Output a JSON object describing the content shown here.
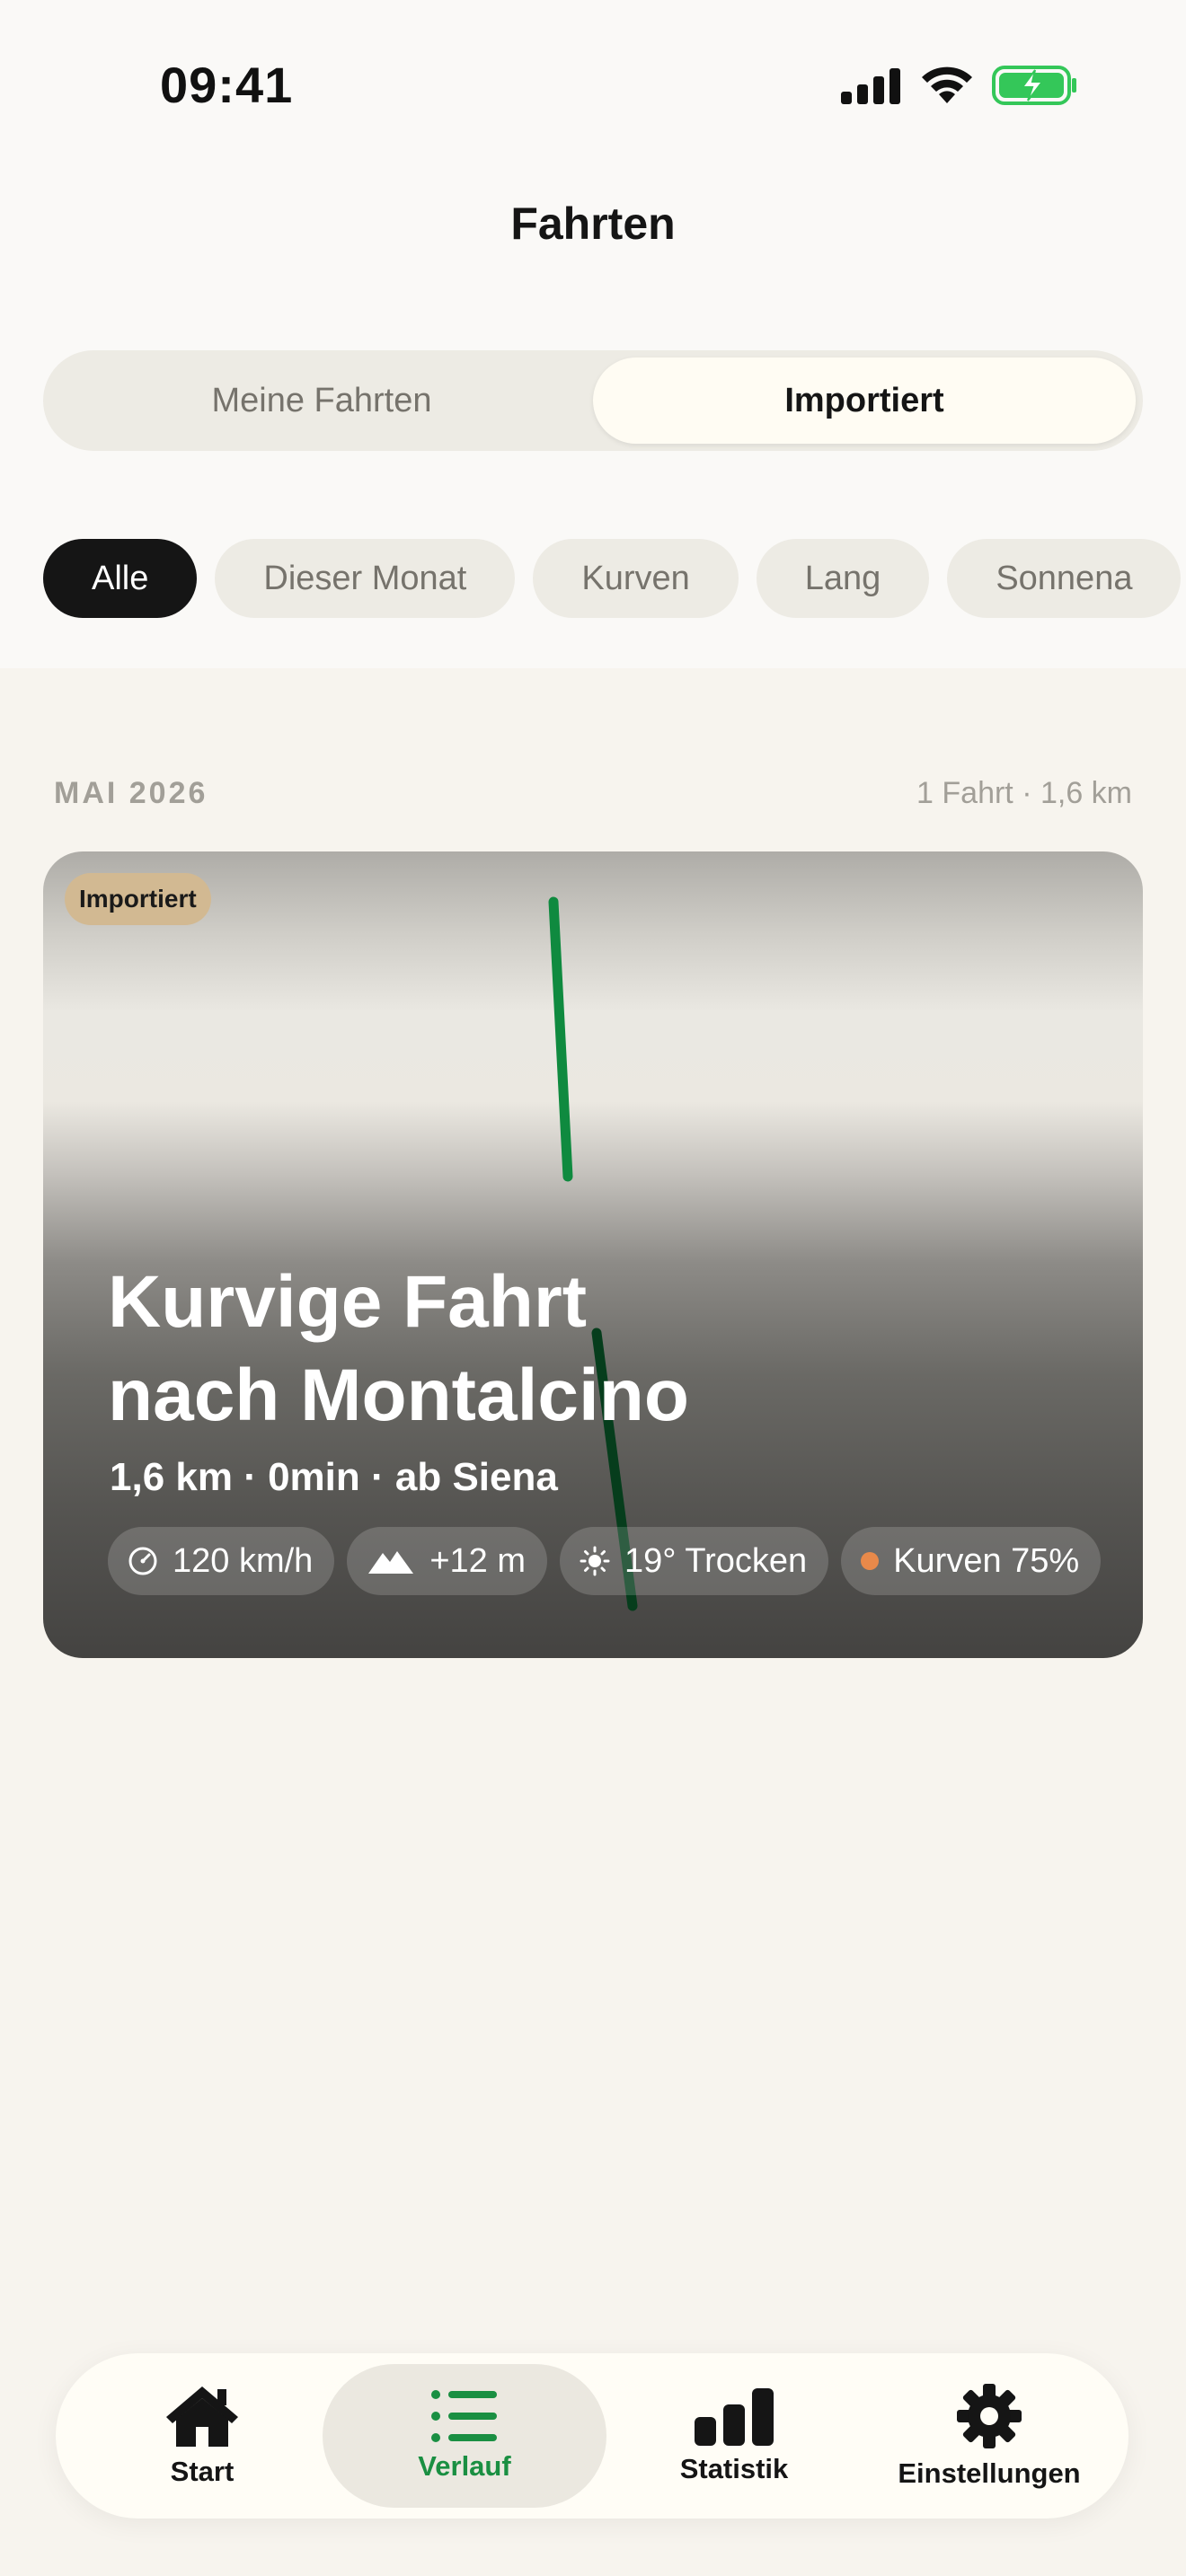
{
  "status_bar": {
    "time": "09:41",
    "battery_color": "#34c759"
  },
  "header": {
    "title": "Fahrten"
  },
  "segmented": {
    "left_label": "Meine Fahrten",
    "right_label": "Importiert",
    "selected": "Importiert"
  },
  "filters": {
    "chips": [
      "Alle",
      "Dieser Monat",
      "Kurven",
      "Lang",
      "Sonnena"
    ],
    "selected": "Alle"
  },
  "section": {
    "title": "MAI 2026",
    "meta": "1 Fahrt · 1,6 km"
  },
  "ride": {
    "badge": "Importiert",
    "title_line1": "Kurvige Fahrt",
    "title_line2": "nach Montalcino",
    "subtitle": "1,6 km · 0min · ab Siena",
    "stats": {
      "speed": "120 km/h",
      "elevation": "+12 m",
      "weather": "19° Trocken",
      "curves": "Kurven 75%"
    },
    "route_color": "#0f8a3f",
    "curves_dot_color": "#e8894a"
  },
  "tabbar": {
    "items": [
      {
        "label": "Start",
        "icon": "house-icon"
      },
      {
        "label": "Verlauf",
        "icon": "list-icon"
      },
      {
        "label": "Statistik",
        "icon": "bar-chart-icon"
      },
      {
        "label": "Einstellungen",
        "icon": "gear-icon"
      }
    ],
    "active": "Verlauf",
    "active_color": "#1a8f42"
  }
}
